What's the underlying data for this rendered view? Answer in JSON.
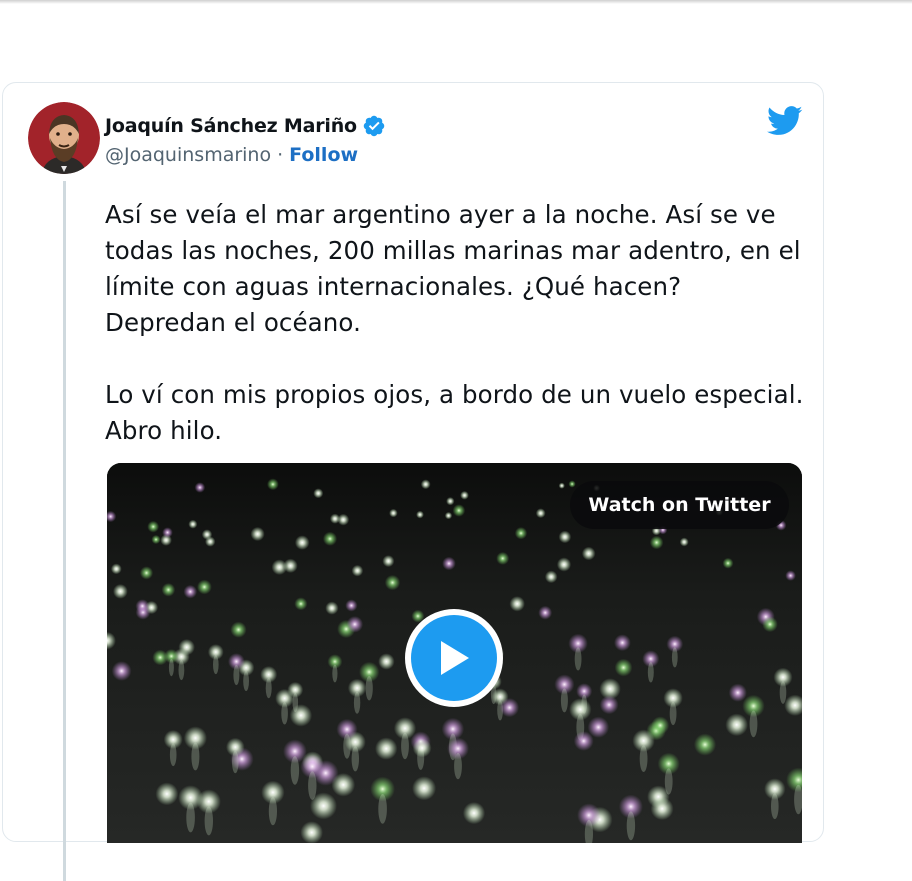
{
  "author": {
    "name": "Joaquín Sánchez Mariño",
    "handle": "@Joaquinsmarino",
    "separator": "·",
    "follow_label": "Follow",
    "verified": true
  },
  "tweet": {
    "text": "Así se veía el mar argentino ayer a la noche. Así se ve todas las noches, 200 millas marinas mar adentro, en el límite con aguas internacionales. ¿Qué hacen? Depredan el océano.\n\nLo ví con mis propios ojos, a bordo de un vuelo especial. Abro hilo."
  },
  "media": {
    "watch_label": "Watch on Twitter",
    "play_icon": "play-icon"
  },
  "colors": {
    "accent": "#1d9bf0",
    "follow": "#1d6fc4",
    "text": "#0f1419",
    "muted": "#536471"
  },
  "icons": [
    "twitter-bird-icon",
    "verified-badge-icon",
    "play-icon"
  ]
}
